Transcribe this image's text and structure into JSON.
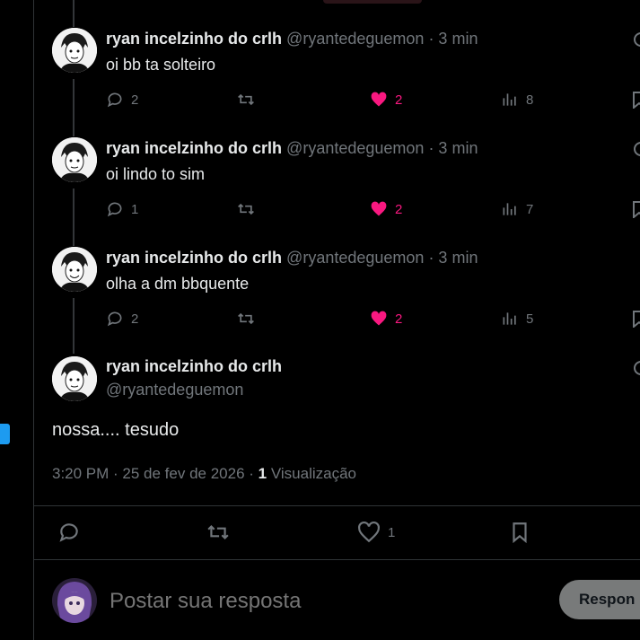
{
  "replies": [
    {
      "name": "ryan incelzinho do crlh",
      "handle": "@ryantedeguemon",
      "time": "· 3 min",
      "text": "oi bb ta solteiro",
      "replies": "2",
      "likes": "2",
      "views": "8"
    },
    {
      "name": "ryan incelzinho do crlh",
      "handle": "@ryantedeguemon",
      "time": "· 3 min",
      "text": "oi lindo to sim",
      "replies": "1",
      "likes": "2",
      "views": "7"
    },
    {
      "name": "ryan incelzinho do crlh",
      "handle": "@ryantedeguemon",
      "time": "· 3 min",
      "text": "olha a dm bbquente",
      "replies": "2",
      "likes": "2",
      "views": "5"
    }
  ],
  "focus": {
    "name": "ryan incelzinho do crlh",
    "handle": "@ryantedeguemon",
    "text": "nossa.... tesudo",
    "timestamp": "3:20 PM · 25 de fev de 2026 ·",
    "views_count": "1",
    "views_label": "Visualização",
    "likes": "1"
  },
  "reply_box": {
    "placeholder": "Postar sua resposta",
    "button": "Respon"
  },
  "colors": {
    "like": "#f91880",
    "muted": "#71767b",
    "text": "#e7e9ea",
    "divider": "#2f3336",
    "accent": "#1d9bf0"
  },
  "icons": [
    "reply-icon",
    "retweet-icon",
    "heart-icon",
    "views-icon",
    "bookmark-icon",
    "more-icon"
  ]
}
